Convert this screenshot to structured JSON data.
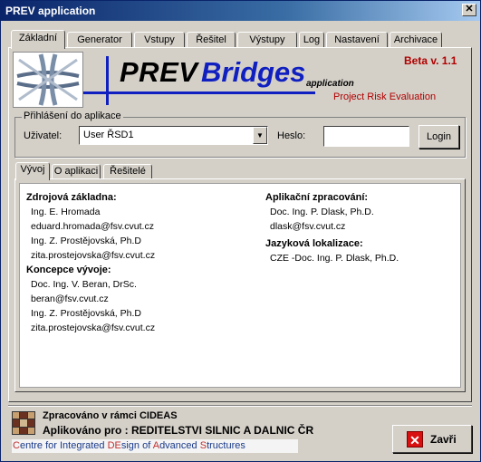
{
  "window": {
    "title": "PREV application"
  },
  "main_tabs": [
    "Základní",
    "Generator",
    "Vstupy",
    "Řešitel",
    "Výstupy",
    "Log",
    "Nastavení",
    "Archivace"
  ],
  "header": {
    "title_prev": "PREV",
    "title_bridges": "Bridges",
    "title_app": "application",
    "beta": "Beta v. 1.1",
    "subtitle": "Project Risk Evaluation"
  },
  "login": {
    "legend": "Přihlášení do aplikace",
    "user_label": "Uživatel:",
    "user_value": "User ŘSD1",
    "password_label": "Heslo:",
    "password_value": "",
    "login_button": "Login"
  },
  "sub_tabs": [
    "Vývoj",
    "O aplikaci",
    "Řešitelé"
  ],
  "content": {
    "left": {
      "h1": "Zdrojová základna:",
      "items1": [
        "Ing. E. Hromada",
        "eduard.hromada@fsv.cvut.cz",
        "Ing. Z. Prostějovská, Ph.D",
        "zita.prostejovska@fsv.cvut.cz"
      ],
      "h2": "Koncepce vývoje:",
      "items2": [
        "Doc. Ing. V. Beran, DrSc.",
        "beran@fsv.cvut.cz",
        "Ing. Z. Prostějovská, Ph.D",
        "zita.prostejovska@fsv.cvut.cz"
      ]
    },
    "right": {
      "h1": "Aplikační zpracování:",
      "items1": [
        "Doc. Ing. P. Dlask, Ph.D.",
        "dlask@fsv.cvut.cz"
      ],
      "h2": "Jazyková lokalizace:",
      "items2": [
        "CZE -Doc. Ing. P. Dlask, Ph.D."
      ]
    }
  },
  "footer": {
    "line1": "Zpracováno v rámci CIDEAS",
    "line2": "Aplikováno pro : REDITELSTVI SILNIC A DALNIC ČR",
    "cideas_parts": [
      {
        "t": "C",
        "red": true
      },
      {
        "t": "entre for Integrated ",
        "red": false
      },
      {
        "t": "DE",
        "red": true
      },
      {
        "t": "sign of ",
        "red": false
      },
      {
        "t": "A",
        "red": true
      },
      {
        "t": "dvanced ",
        "red": false
      },
      {
        "t": "S",
        "red": true
      },
      {
        "t": "tructures",
        "red": false
      }
    ],
    "close_button": "Zavři"
  },
  "colors": {
    "accent_blue": "#1020c0",
    "beta_red": "#b00000",
    "titlebar": "#0a246a"
  }
}
